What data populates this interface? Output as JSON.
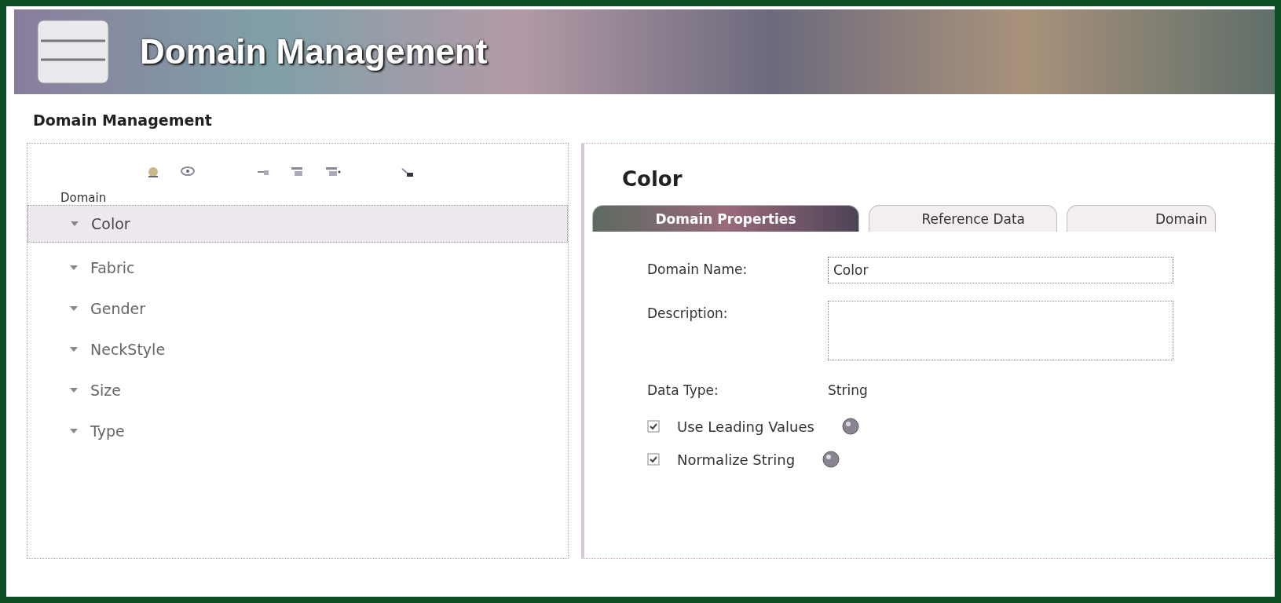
{
  "banner": {
    "title": "Domain Management"
  },
  "page_title": "Domain Management",
  "domain_list": {
    "header": "Domain",
    "items": [
      {
        "label": "Color",
        "selected": true
      },
      {
        "label": "Fabric",
        "selected": false
      },
      {
        "label": "Gender",
        "selected": false
      },
      {
        "label": "NeckStyle",
        "selected": false
      },
      {
        "label": "Size",
        "selected": false
      },
      {
        "label": "Type",
        "selected": false
      }
    ]
  },
  "detail": {
    "title": "Color",
    "tabs": [
      {
        "label": "Domain Properties",
        "selected": true
      },
      {
        "label": "Reference Data",
        "selected": false
      },
      {
        "label": "Domain",
        "selected": false
      }
    ],
    "domain_name": {
      "label": "Domain Name:",
      "value": "Color"
    },
    "description": {
      "label": "Description:"
    },
    "data_type": {
      "label": "Data Type:",
      "value": "String"
    },
    "options": [
      {
        "label": "Use Leading Values",
        "checked": true
      },
      {
        "label": "Normalize String",
        "checked": true
      }
    ]
  }
}
